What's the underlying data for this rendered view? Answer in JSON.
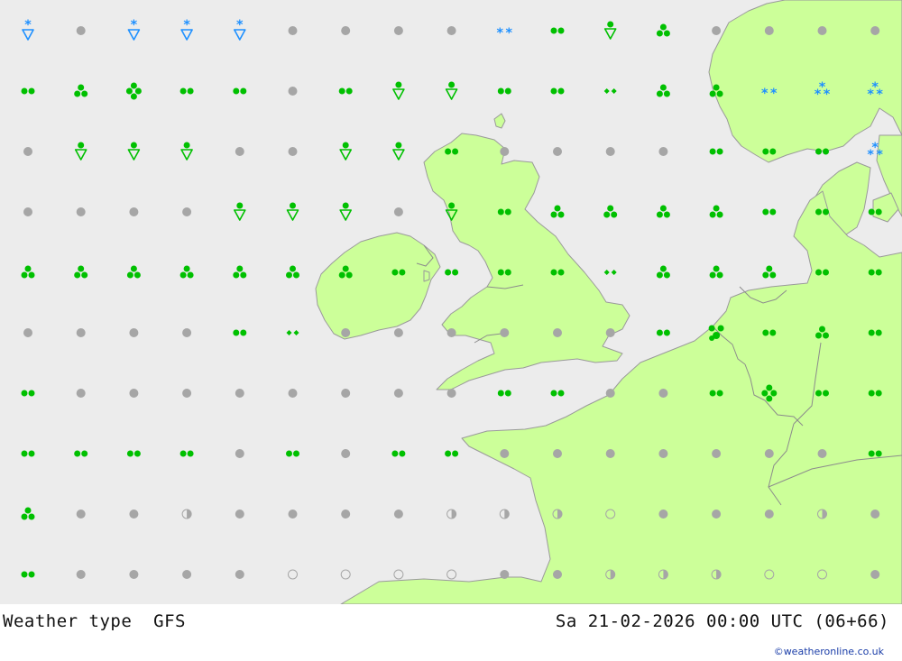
{
  "footer": {
    "title": "Weather type",
    "model": "GFS",
    "datetime": "Sa 21-02-2026 00:00 UTC (06+66)",
    "credit": "©weatheronline.co.uk"
  },
  "colors": {
    "sea": "#ececec",
    "land": "#ccff99",
    "coast": "#9a9a9a",
    "cloudy": "#a6a6a6",
    "rain": "#00c000",
    "snow": "#1e90ff"
  },
  "grid": {
    "columns": 17,
    "rows": 10
  },
  "legend_symbols": {
    "c": "cloudy-dot",
    "h": "half-clear-circle",
    "o": "clear-circle",
    "r2": "rain-two-drops",
    "d2": "drizzle-two-diamonds",
    "r3": "rain-three-drops",
    "d4": "rain-four-drops",
    "s": "rain-shower-triangle",
    "sn": "snow-shower-triangle",
    "n2": "snow-two-stars",
    "n3": "snow-three-stars",
    "rp": "rain-two-drops-with-pellet"
  },
  "symbols": [
    [
      "sn",
      "c",
      "sn",
      "sn",
      "sn",
      "c",
      "c",
      "c",
      "c",
      "n2",
      "r2",
      "s",
      "r3",
      "c",
      "c",
      "c",
      "c"
    ],
    [
      "r2",
      "r3",
      "d4",
      "r2",
      "r2",
      "c",
      "r2",
      "s",
      "s",
      "r2",
      "r2",
      "d2",
      "r3",
      "r3",
      "n2",
      "n3",
      "n3"
    ],
    [
      "c",
      "s",
      "s",
      "s",
      "c",
      "c",
      "s",
      "s",
      "r2",
      "c",
      "c",
      "c",
      "c",
      "r2",
      "r2",
      "r2",
      "n3"
    ],
    [
      "c",
      "c",
      "c",
      "c",
      "s",
      "s",
      "s",
      "c",
      "s",
      "r2",
      "r3",
      "r3",
      "r3",
      "r3",
      "r2",
      "r2",
      "r2"
    ],
    [
      "r3",
      "r3",
      "r3",
      "r3",
      "r3",
      "r3",
      "r3",
      "r2",
      "r2",
      "r2",
      "r2",
      "d2",
      "r3",
      "r3",
      "r3",
      "r2",
      "r2"
    ],
    [
      "c",
      "c",
      "c",
      "c",
      "r2",
      "d2",
      "c",
      "c",
      "c",
      "c",
      "c",
      "c",
      "r2",
      "rp",
      "r2",
      "r3",
      "r2"
    ],
    [
      "r2",
      "c",
      "c",
      "c",
      "c",
      "c",
      "c",
      "c",
      "c",
      "r2",
      "r2",
      "c",
      "c",
      "r2",
      "d4",
      "r2",
      "r2"
    ],
    [
      "r2",
      "r2",
      "r2",
      "r2",
      "c",
      "r2",
      "c",
      "r2",
      "r2",
      "c",
      "c",
      "c",
      "c",
      "c",
      "c",
      "c",
      "r2"
    ],
    [
      "r3",
      "c",
      "c",
      "h",
      "c",
      "c",
      "c",
      "c",
      "h",
      "h",
      "h",
      "o",
      "c",
      "c",
      "c",
      "h",
      "c"
    ],
    [
      "r2",
      "c",
      "c",
      "c",
      "c",
      "o",
      "o",
      "o",
      "o",
      "c",
      "c",
      "h",
      "h",
      "h",
      "o",
      "o",
      "c"
    ]
  ]
}
